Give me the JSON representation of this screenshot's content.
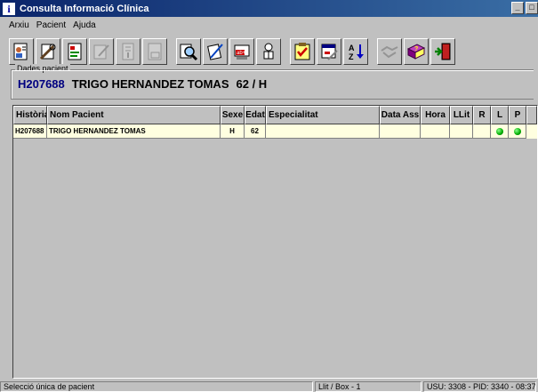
{
  "window": {
    "title": "Consulta Informació Clínica",
    "icon_glyph": "i",
    "buttons": [
      "_",
      "□"
    ]
  },
  "menu": [
    "Arxiu",
    "Pacient",
    "Ajuda"
  ],
  "toolbar": [
    {
      "icon": "patient-card-icon",
      "enabled": true
    },
    {
      "icon": "tools-icon",
      "enabled": true
    },
    {
      "icon": "document-icon",
      "enabled": true
    },
    {
      "icon": "edit-document-icon",
      "enabled": false
    },
    {
      "icon": "list-icon",
      "enabled": false
    },
    {
      "icon": "hb-document-icon",
      "enabled": false
    },
    {
      "icon": "search-icon",
      "enabled": true
    },
    {
      "icon": "notes-icon",
      "enabled": true
    },
    {
      "icon": "lab-icon",
      "enabled": true
    },
    {
      "icon": "doctor-icon",
      "enabled": true
    },
    {
      "icon": "checklist-icon",
      "enabled": true
    },
    {
      "icon": "calendar-icon",
      "enabled": true
    },
    {
      "icon": "sort-az-icon",
      "enabled": true
    },
    {
      "icon": "handshake-icon",
      "enabled": false
    },
    {
      "icon": "help-book-icon",
      "enabled": true
    },
    {
      "icon": "exit-icon",
      "enabled": true
    }
  ],
  "patient": {
    "legend": "Dades pacient",
    "history": "H207688",
    "name": "TRIGO HERNANDEZ TOMAS",
    "age_sex": "62 / H"
  },
  "grid": {
    "columns": [
      "Història",
      "Nom Pacient",
      "Sexe",
      "Edat",
      "Especialitat",
      "Data Ass",
      "Hora",
      "LLit",
      "R",
      "L",
      "P"
    ],
    "rows": [
      {
        "historia": "H207688",
        "nom": "TRIGO HERNANDEZ TOMAS",
        "sexe": "H",
        "edat": "62",
        "especialitat": "",
        "data": "",
        "hora": "",
        "llit": "",
        "r": "",
        "l": "green",
        "p": "green"
      }
    ]
  },
  "status": {
    "message": "Selecció única de pacient",
    "bed": "Llit / Box - 1",
    "session": "USU: 3308 - PID: 3340 - 08:37"
  }
}
